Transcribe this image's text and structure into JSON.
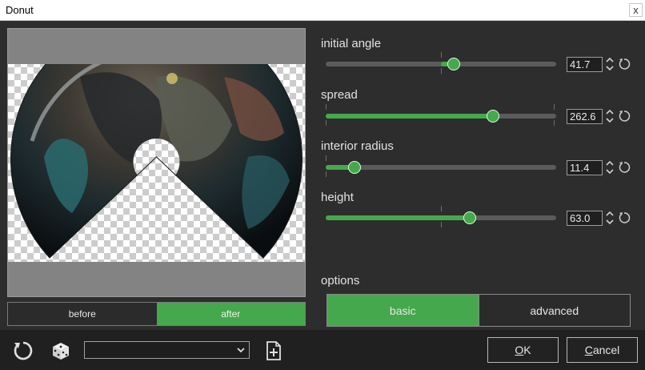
{
  "window": {
    "title": "Donut",
    "close_glyph": "x"
  },
  "preview": {
    "toggle": [
      {
        "label": "before",
        "selected": false
      },
      {
        "label": "after",
        "selected": true
      }
    ]
  },
  "params": [
    {
      "id": "initial-angle",
      "label": "initial angle",
      "value": "41.7",
      "fraction": 0.555
    },
    {
      "id": "spread",
      "label": "spread",
      "value": "262.6",
      "fraction": 0.725
    },
    {
      "id": "interior-radius",
      "label": "interior radius",
      "value": "11.4",
      "fraction": 0.125
    },
    {
      "id": "height",
      "label": "height",
      "value": "63.0",
      "fraction": 0.625
    }
  ],
  "options": {
    "label": "options",
    "tabs": [
      {
        "label": "basic",
        "selected": true
      },
      {
        "label": "advanced",
        "selected": false
      }
    ]
  },
  "footer": {
    "preset_value": "",
    "ok_label": "OK",
    "ok_accel": "O",
    "ok_rest": "K",
    "cancel_label": "Cancel",
    "cancel_accel": "C",
    "cancel_rest": "ancel"
  },
  "colors": {
    "accent": "#46a84c",
    "background": "#2d2d2d",
    "bar": "#202020"
  },
  "icons": [
    "reset-icon",
    "dice-icon",
    "chevron-down-icon",
    "add-preset-icon",
    "spin-arrows-icon",
    "reset-small-icon"
  ]
}
